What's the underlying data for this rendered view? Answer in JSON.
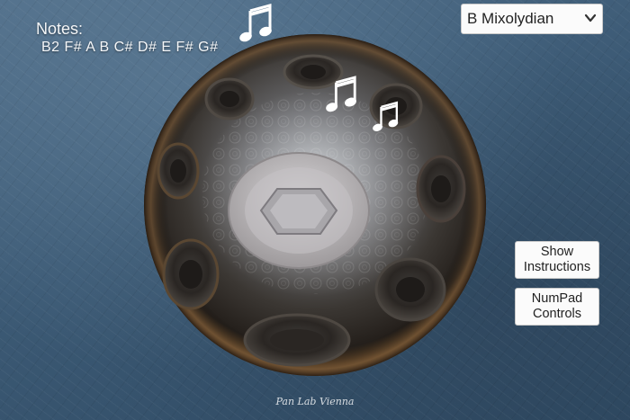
{
  "notes_panel": {
    "title": "Notes:",
    "list": "B2 F# A B C# D# E F# G#"
  },
  "scale_select": {
    "selected": "B Mixolydian",
    "icon": "chevron-down-icon"
  },
  "buttons": {
    "instructions": "Show\nInstructions",
    "numpad": "NumPad\nControls"
  },
  "logo": "Pan Lab Vienna",
  "icons": {
    "music_note": "double-eighth-note-icon"
  },
  "colors": {
    "background": "#3f5d78",
    "drum_shell": "#2a2724",
    "drum_rim": "#7a5a38",
    "center_ding": "#b8b6b8",
    "button_bg": "#fbfbfb"
  }
}
